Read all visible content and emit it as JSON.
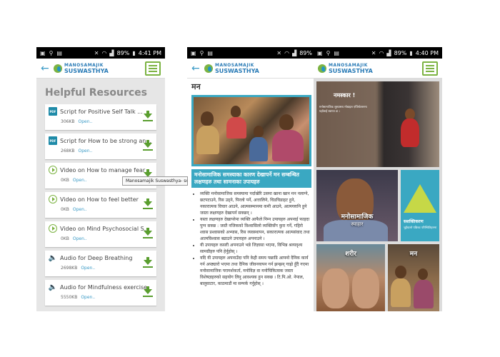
{
  "app": {
    "logo_line1": "MANOSAMAJIK",
    "logo_line2": "SUSWASTHYA"
  },
  "status": {
    "screens": [
      {
        "battery": "89%",
        "time": "4:41 PM"
      },
      {
        "battery": "89%",
        "time": ""
      },
      {
        "battery": "89%",
        "time": "4:40 PM"
      }
    ]
  },
  "resources": {
    "title": "Helpful Resources",
    "items": [
      {
        "icon": "pdf-icon",
        "name": "Script for Positive Self Talk ...",
        "size": "306KB",
        "action": "Open.."
      },
      {
        "icon": "pdf-icon",
        "name": "Script for How to be strong an...",
        "size": "268KB",
        "action": "Open.."
      },
      {
        "icon": "play-icon",
        "name": "Video on How to manage fear",
        "size": "0KB",
        "action": "Open.."
      },
      {
        "icon": "play-icon",
        "name": "Video on How to feel better",
        "size": "0KB",
        "action": "Open.."
      },
      {
        "icon": "play-icon",
        "name": "Video on Mind Psychosocial Sym...",
        "size": "0KB",
        "action": "Open.."
      },
      {
        "icon": "audio-icon",
        "name": "Audio for Deep Breathing",
        "size": "2698KB",
        "action": "Open.."
      },
      {
        "icon": "audio-icon",
        "name": "Audio for Mindfulness exercise",
        "size": "5550KB",
        "action": "Open.."
      }
    ],
    "tooltip": "Manosamajik Suswasthya- scre"
  },
  "article": {
    "title": "मन",
    "heading": "मनोसामाजिक समस्याका कारण देखापर्ने मन सम्बन्धित लक्षणहरु तथा सामनाका उपायहरु",
    "bullets": [
      "व्यक्ति मनोसामाजिक समस्यामा पर्दाखेरि उसमा खाना खान मन नलाग्ने, छटपटाउने, रिस उठ्ने, पिरलो पर्ने, अत्तालिने, चिडचिडाहट हुने, नकारात्मक विचार आउने, आत्मसम्मानमा कमी आउने, आत्मग्लानि हुने जस्ता लक्षणहरु देखापर्न सक्छन् ।",
      "यस्ता लक्षणहरु देखापरेमा व्यक्ति आफैले निम्न उपायहरु अपनाई फाइदा पुग्न सक्छ : जस्तै नजिकको विश्वासिलो व्यक्तिसँग कुरा गर्ने, गहिरो श्वास प्रश्वासको अभ्यास, रिस व्यवस्थापन, सकारात्मक आत्मसंवाद तथा आत्मविश्वास बढाउने उपायहरु अपनाउने ।",
      "यी उपायहरु कसरी अपनाउने भन्ने जिज्ञासा भएमा, विभिन्न श्रव्यदृश्य सामग्रीहरु पनि हेर्नुहोस् ।",
      "यदि यी उपायहरु अपनाउँदा पनि केही समय पछाडि आफ्नो दैनिक कार्य गर्न अप्ठ्यारो भएमा तथा दैनिक जीवनयापन गर्न झन्झन् गाह्रो हुँदै गएमा मनोसामाजिक परामर्शकर्ता, मनोविज्ञ वा मनोचिकित्सक जस्ता विशेषज्ञहरुको सहयोग लिनु आवश्यक हुन सक्छ । टि.पि.ओ. नेपाल, बालुवाटार, काठमाडौं मा सम्पर्क गर्नुहोस् ।"
    ]
  },
  "home": {
    "welcome_title": "नमस्कार !",
    "welcome_text": "मनोसामाजिक सुस्वास्थ्य मोबाइल एप्लिकेसनमा यहाँलाई स्वागत छ ।",
    "tiles": [
      {
        "label": "मनोसामाजिक",
        "sublabel": "स्याहार"
      },
      {
        "label": "सशक्तिकरण",
        "sublabel": "भुइँचालो पछिका परिस्थितिहरुमा"
      },
      {
        "label": "शरीर",
        "sublabel": ""
      },
      {
        "label": "मन",
        "sublabel": ""
      }
    ]
  },
  "colors": {
    "brand_green": "#7cb342",
    "brand_blue": "#3aa8c2",
    "download_green": "#5a9e2f"
  }
}
